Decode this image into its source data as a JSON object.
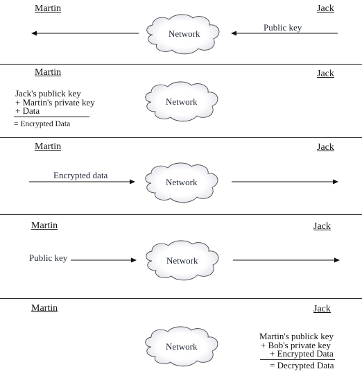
{
  "parties": {
    "sender": "Martin",
    "receiver": "Jack"
  },
  "network_label": "Network",
  "steps": [
    {
      "arrow_direction": "right-to-left",
      "message": "Public key"
    },
    {
      "computation_side": "Martin",
      "computation": [
        "Jack's publick key",
        "+ Martin's private key",
        "+ Data"
      ],
      "result": "= Encrypted Data"
    },
    {
      "arrow_direction": "left-to-right",
      "message": "Encrypted data"
    },
    {
      "arrow_direction": "left-to-right",
      "message": "Public key"
    },
    {
      "computation_side": "Jack",
      "computation": [
        "Martin's publick key",
        "+ Bob's private key",
        "+ Encrypted Data"
      ],
      "result": "= Decrypted Data"
    }
  ]
}
